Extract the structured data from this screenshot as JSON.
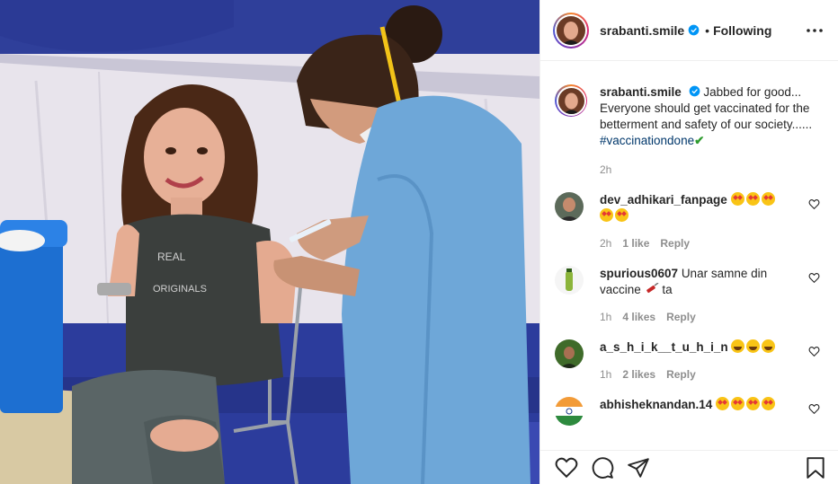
{
  "post": {
    "username": "srabanti.smile",
    "separator": "•",
    "follow_status": "Following",
    "caption_text": "Jabbed for good... Everyone should get vaccinated for the betterment and safety of our society......",
    "hashtag": "#vaccinationdone",
    "caption_emoji": "✔",
    "time": "2h"
  },
  "comments": [
    {
      "username": "dev_adhikari_fanpage",
      "text": "",
      "emojis": 5,
      "emoji_kind": "star-struck",
      "time": "2h",
      "likes": "1 like",
      "reply": "Reply"
    },
    {
      "username": "spurious0607",
      "text": "Unar samne din vaccine",
      "text_after": "ta",
      "emoji_kind": "syringe",
      "time": "1h",
      "likes": "4 likes",
      "reply": "Reply"
    },
    {
      "username": "a_s_h_i_k__t_u_h_i_n",
      "text": "",
      "emojis": 3,
      "emoji_kind": "laughing",
      "time": "1h",
      "likes": "2 likes",
      "reply": "Reply"
    },
    {
      "username": "abhisheknandan.14",
      "text": "",
      "emojis": 4,
      "emoji_kind": "star-struck"
    }
  ],
  "icons": {
    "more": "more-options-icon",
    "verified": "verified-badge-icon",
    "like": "heart-icon",
    "comment": "comment-icon",
    "share": "share-icon",
    "save": "bookmark-icon"
  },
  "colors": {
    "verified_blue": "#0095f6",
    "hashtag": "#00376b",
    "meta_gray": "#8e8e8e",
    "scrubs_blue": "#6ea7d8"
  }
}
